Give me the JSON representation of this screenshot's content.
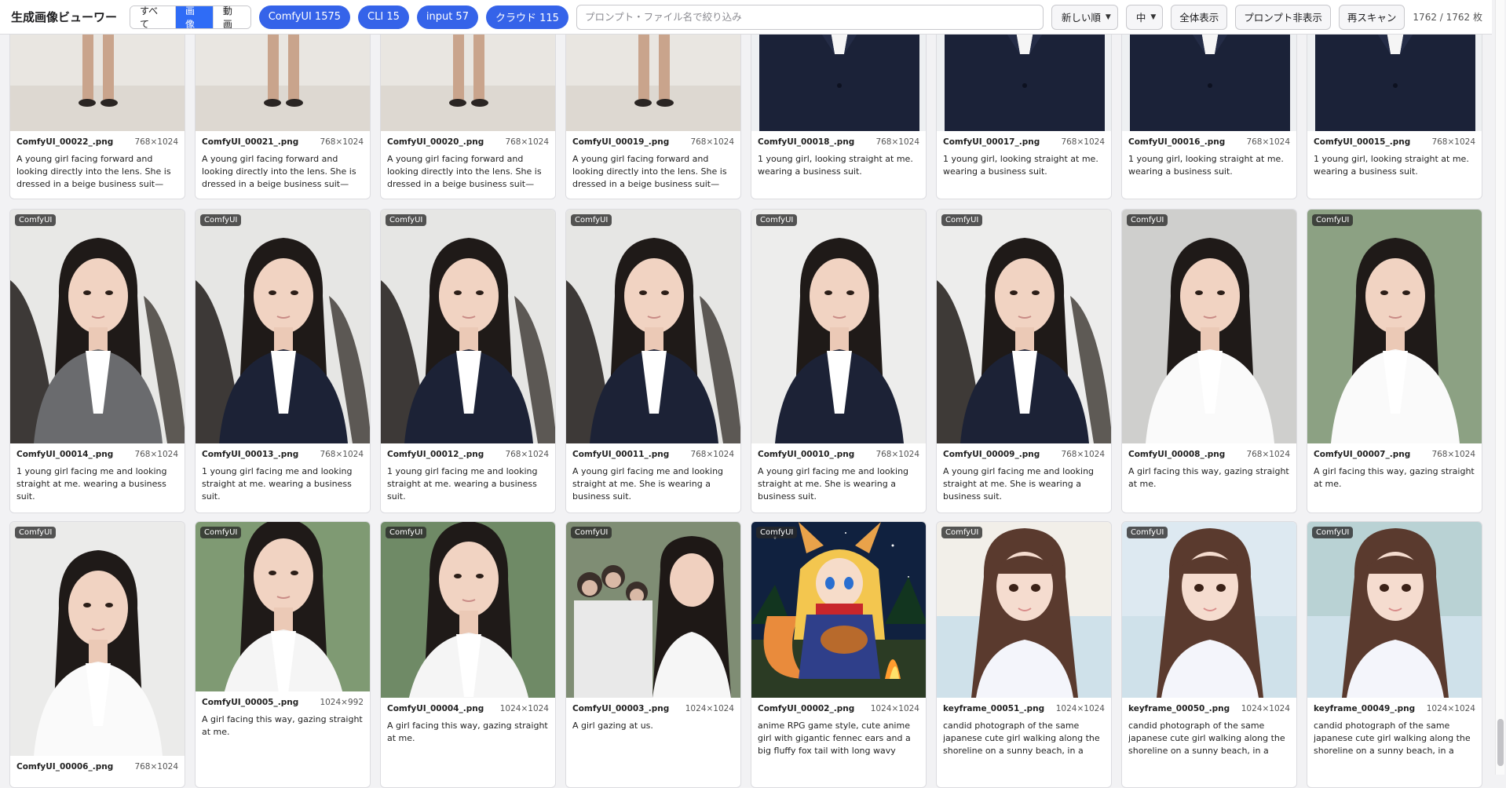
{
  "app": {
    "title": "生成画像ビューワー"
  },
  "filters": {
    "all": "すべて",
    "images": "画像",
    "video": "動画"
  },
  "sources": [
    {
      "label": "ComfyUI 1575"
    },
    {
      "label": "CLI 15"
    },
    {
      "label": "input 57"
    },
    {
      "label": "クラウド 115"
    }
  ],
  "search": {
    "placeholder": "プロンプト・ファイル名で絞り込み",
    "value": ""
  },
  "sort": {
    "value": "新しい順"
  },
  "size": {
    "value": "中"
  },
  "buttons": {
    "show_all": "全体表示",
    "hide_prompt": "プロンプト非表示",
    "rescan": "再スキャン"
  },
  "counter": "1762 / 1762 枚",
  "colors": {
    "accent": "#2f6cf6",
    "pill": "#3563e9"
  },
  "cards": [
    {
      "name": "ComfyUI_00022_.png",
      "dims": "768×1024",
      "prompt": "A young girl facing forward and looking directly into the lens. She is dressed in a beige business suit—",
      "badge": ""
    },
    {
      "name": "ComfyUI_00021_.png",
      "dims": "768×1024",
      "prompt": "A young girl facing forward and looking directly into the lens. She is dressed in a beige business suit—",
      "badge": ""
    },
    {
      "name": "ComfyUI_00020_.png",
      "dims": "768×1024",
      "prompt": "A young girl facing forward and looking directly into the lens. She is dressed in a beige business suit—",
      "badge": ""
    },
    {
      "name": "ComfyUI_00019_.png",
      "dims": "768×1024",
      "prompt": "A young girl facing forward and looking directly into the lens. She is dressed in a beige business suit—",
      "badge": ""
    },
    {
      "name": "ComfyUI_00018_.png",
      "dims": "768×1024",
      "prompt": "1 young girl, looking straight at me. wearing a business suit.",
      "badge": ""
    },
    {
      "name": "ComfyUI_00017_.png",
      "dims": "768×1024",
      "prompt": "1 young girl, looking straight at me. wearing a business suit.",
      "badge": ""
    },
    {
      "name": "ComfyUI_00016_.png",
      "dims": "768×1024",
      "prompt": "1 young girl, looking straight at me. wearing a business suit.",
      "badge": ""
    },
    {
      "name": "ComfyUI_00015_.png",
      "dims": "768×1024",
      "prompt": "1 young girl, looking straight at me. wearing a business suit.",
      "badge": ""
    },
    {
      "name": "ComfyUI_00014_.png",
      "dims": "768×1024",
      "prompt": "1 young girl facing me and looking straight at me. wearing a business suit.",
      "badge": "ComfyUI"
    },
    {
      "name": "ComfyUI_00013_.png",
      "dims": "768×1024",
      "prompt": "1 young girl facing me and looking straight at me. wearing a business suit.",
      "badge": "ComfyUI"
    },
    {
      "name": "ComfyUI_00012_.png",
      "dims": "768×1024",
      "prompt": "1 young girl facing me and looking straight at me. wearing a business suit.",
      "badge": "ComfyUI"
    },
    {
      "name": "ComfyUI_00011_.png",
      "dims": "768×1024",
      "prompt": "A young girl facing me and looking straight at me. She is wearing a business suit.",
      "badge": "ComfyUI"
    },
    {
      "name": "ComfyUI_00010_.png",
      "dims": "768×1024",
      "prompt": "A young girl facing me and looking straight at me. She is wearing a business suit.",
      "badge": "ComfyUI"
    },
    {
      "name": "ComfyUI_00009_.png",
      "dims": "768×1024",
      "prompt": "A young girl facing me and looking straight at me. She is wearing a business suit.",
      "badge": "ComfyUI"
    },
    {
      "name": "ComfyUI_00008_.png",
      "dims": "768×1024",
      "prompt": "A girl facing this way, gazing straight at me.",
      "badge": "ComfyUI"
    },
    {
      "name": "ComfyUI_00007_.png",
      "dims": "768×1024",
      "prompt": "A girl facing this way, gazing straight at me.",
      "badge": "ComfyUI"
    },
    {
      "name": "ComfyUI_00006_.png",
      "dims": "768×1024",
      "prompt": "",
      "badge": "ComfyUI"
    },
    {
      "name": "ComfyUI_00005_.png",
      "dims": "1024×992",
      "prompt": "A girl facing this way, gazing straight at me.",
      "badge": "ComfyUI"
    },
    {
      "name": "ComfyUI_00004_.png",
      "dims": "1024×1024",
      "prompt": "A girl facing this way, gazing straight at me.",
      "badge": "ComfyUI"
    },
    {
      "name": "ComfyUI_00003_.png",
      "dims": "1024×1024",
      "prompt": "A girl gazing at us.",
      "badge": "ComfyUI"
    },
    {
      "name": "ComfyUI_00002_.png",
      "dims": "1024×1024",
      "prompt": "anime RPG game style, cute anime girl with gigantic fennec ears and a big fluffy fox tail with long wavy",
      "badge": "ComfyUI"
    },
    {
      "name": "keyframe_00051_.png",
      "dims": "1024×1024",
      "prompt": "candid photograph of the same japanese cute girl walking along the shoreline on a sunny beach, in a white",
      "badge": "ComfyUI"
    },
    {
      "name": "keyframe_00050_.png",
      "dims": "1024×1024",
      "prompt": "candid photograph of the same japanese cute girl walking along the shoreline on a sunny beach, in a white",
      "badge": "ComfyUI"
    },
    {
      "name": "keyframe_00049_.png",
      "dims": "1024×1024",
      "prompt": "candid photograph of the same japanese cute girl walking along the shoreline on a sunny beach, in a white",
      "badge": "ComfyUI"
    }
  ]
}
